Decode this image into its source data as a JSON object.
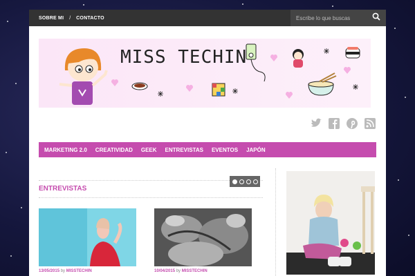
{
  "topbar": {
    "links": [
      "SOBRE MI",
      "CONTACTO"
    ],
    "separator": "/",
    "search_placeholder": "Escribe lo que buscas"
  },
  "banner": {
    "title": "MISS TECHIN"
  },
  "social": [
    "twitter-icon",
    "facebook-icon",
    "pinterest-icon",
    "rss-icon"
  ],
  "mainnav": [
    "MARKETING 2.0",
    "CREATIVIDAD",
    "GEEK",
    "ENTREVISTAS",
    "EVENTOS",
    "JAPÓN"
  ],
  "section": {
    "title": "ENTREVISTAS"
  },
  "posts": [
    {
      "date": "13/05/2015",
      "by": "by",
      "author": "MISSTECHIN"
    },
    {
      "date": "10/04/2015",
      "by": "by",
      "author": "MISSTECHIN"
    }
  ],
  "colors": {
    "accent": "#c54cae",
    "topbar": "#333333"
  }
}
